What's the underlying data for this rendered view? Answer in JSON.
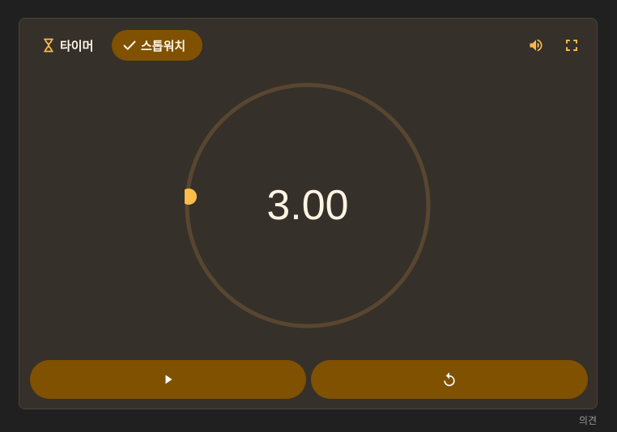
{
  "tabs": [
    {
      "label": "타이머",
      "icon": "hourglass-icon",
      "selected": false
    },
    {
      "label": "스톱워치",
      "icon": "check-icon",
      "selected": true
    }
  ],
  "controls": {
    "volume_icon": "volume-icon",
    "fullscreen_icon": "fullscreen-icon"
  },
  "display": {
    "time": "3.00"
  },
  "buttons": {
    "start_icon": "play-icon",
    "reset_icon": "reset-icon"
  },
  "footer": {
    "feedback": "의견"
  },
  "colors": {
    "accent": "#7f5100",
    "indicator": "#fbbc4a",
    "icon": "#fdb94a",
    "ring": "#584630",
    "card": "#36302a",
    "page": "#202020"
  }
}
